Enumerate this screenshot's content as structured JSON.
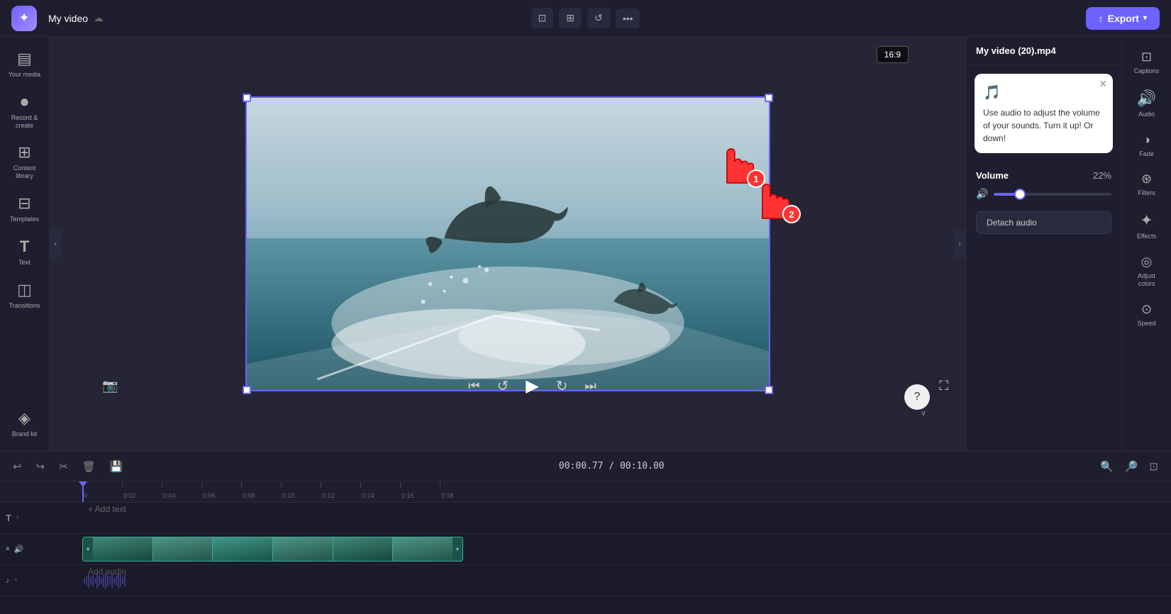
{
  "app": {
    "logo": "✦",
    "project_title": "My video",
    "cloud_icon": "☁",
    "aspect_ratio": "16:9"
  },
  "toolbar": {
    "crop_icon": "⊡",
    "layout_icon": "⊞",
    "undo_icon": "↺",
    "more_icon": "···",
    "export_label": "Export",
    "export_icon": "↑"
  },
  "left_sidebar": {
    "items": [
      {
        "id": "your-media",
        "label": "Your media",
        "icon": "▤"
      },
      {
        "id": "record",
        "label": "Record &\ncreate",
        "icon": "⏺"
      },
      {
        "id": "content-library",
        "label": "Content library",
        "icon": "⊞"
      },
      {
        "id": "templates",
        "label": "Templates",
        "icon": "⊟"
      },
      {
        "id": "text",
        "label": "Text",
        "icon": "T"
      },
      {
        "id": "transitions",
        "label": "Transitions",
        "icon": "◫"
      },
      {
        "id": "brand",
        "label": "Brand kit",
        "icon": "◈"
      }
    ]
  },
  "right_sidebar": {
    "items": [
      {
        "id": "captions",
        "label": "Captions",
        "icon": "⊡"
      },
      {
        "id": "audio",
        "label": "Audio",
        "icon": "🔊"
      },
      {
        "id": "fade",
        "label": "Fade",
        "icon": "◑"
      },
      {
        "id": "filters",
        "label": "Filters",
        "icon": "⊛"
      },
      {
        "id": "effects",
        "label": "Effects",
        "icon": "✦"
      },
      {
        "id": "adjust-colors",
        "label": "Adjust colors",
        "icon": "◎"
      },
      {
        "id": "speed",
        "label": "Speed",
        "icon": "⊙"
      }
    ]
  },
  "panel": {
    "title": "My video (20).mp4",
    "tooltip": {
      "emoji": "🎵",
      "text": "Use audio to adjust the volume of your sounds. Turn it up! Or down!"
    },
    "volume": {
      "label": "Volume",
      "value": "22%",
      "percent": 22
    },
    "detach_label": "Detach audio"
  },
  "timeline": {
    "time_current": "00:00.77",
    "time_total": "00:10.00",
    "time_display": "00:00.77 / 00:10.00",
    "marks": [
      "0",
      "0:02",
      "0:04",
      "0:06",
      "0:08",
      "0:10",
      "0:12",
      "0:14",
      "0:16",
      "0:18"
    ],
    "tracks": [
      {
        "id": "text-track",
        "label": "T",
        "type": "text",
        "add_label": "+ Add text"
      },
      {
        "id": "video-track",
        "label": "🎬",
        "type": "video"
      },
      {
        "id": "audio-track",
        "label": "♪",
        "type": "audio",
        "add_label": "Add audio"
      }
    ]
  },
  "video_controls": {
    "skip_back_icon": "⏮",
    "rewind_icon": "↺",
    "play_icon": "▶",
    "forward_icon": "↻",
    "skip_fwd_icon": "⏭",
    "screenshot_icon": "📷",
    "fullscreen_icon": "⛶"
  },
  "annotations": {
    "cursor_1_badge": "1",
    "cursor_2_badge": "2"
  }
}
